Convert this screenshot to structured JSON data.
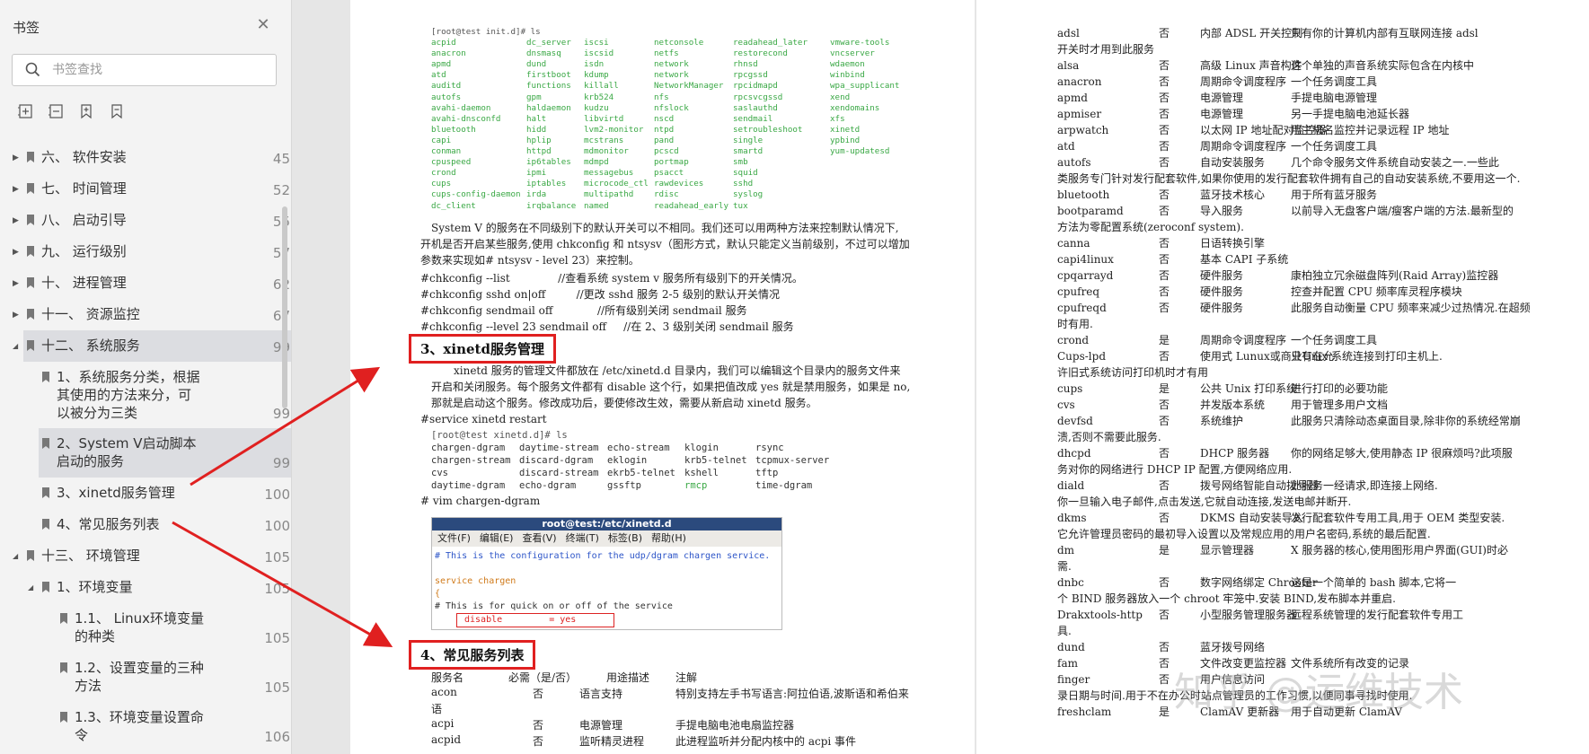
{
  "sidebar": {
    "title": "书签",
    "search_placeholder": "书签查找",
    "tools": [
      "expand-all-icon",
      "collapse-all-icon",
      "add-bookmark-icon",
      "bookmark-icon"
    ],
    "items": [
      {
        "label": "六、 软件安装",
        "page": "45",
        "level": 0,
        "arrow": "▶"
      },
      {
        "label": "七、 时间管理",
        "page": "52",
        "level": 0,
        "arrow": "▶"
      },
      {
        "label": "八、 启动引导",
        "page": "55",
        "level": 0,
        "arrow": "▶"
      },
      {
        "label": "九、 运行级别",
        "page": "57",
        "level": 0,
        "arrow": "▶"
      },
      {
        "label": "十、 进程管理",
        "page": "62",
        "level": 0,
        "arrow": "▶"
      },
      {
        "label": "十一、 资源监控",
        "page": "67",
        "level": 0,
        "arrow": "▶"
      },
      {
        "label": "十二、 系统服务",
        "page": "99",
        "level": 0,
        "arrow": "◢",
        "selected": true
      },
      {
        "label": "1、系统服务分类，根据其使用的方法来分，可以被分为三类",
        "lines": [
          "1、系统服务分类，根据",
          "其使用的方法来分，可",
          "以被分为三类"
        ],
        "page": "99",
        "level": 1
      },
      {
        "label": "2、System V启动脚本启动的服务",
        "lines": [
          "2、System V启动脚本",
          "启动的服务"
        ],
        "page": "99",
        "level": 1,
        "selected": true
      },
      {
        "label": "3、xinetd服务管理",
        "page": "100",
        "level": 1
      },
      {
        "label": "4、常见服务列表",
        "page": "100",
        "level": 1
      },
      {
        "label": "十三、 环境管理",
        "page": "105",
        "level": 0,
        "arrow": "◢"
      },
      {
        "label": "1、环境变量",
        "page": "105",
        "level": 1,
        "arrow": "◢"
      },
      {
        "label": "1.1、 Linux环境变量的种类",
        "lines": [
          "1.1、 Linux环境变量",
          "的种类"
        ],
        "page": "105",
        "level": 2
      },
      {
        "label": "1.2、设置变量的三种方法",
        "lines": [
          "1.2、设置变量的三种",
          "方法"
        ],
        "page": "105",
        "level": 2
      },
      {
        "label": "1.3、环境变量设置命令",
        "lines": [
          "1.3、环境变量设置命",
          "令"
        ],
        "page": "106",
        "level": 2
      }
    ]
  },
  "left_page": {
    "ls_cmd": "[root@test init.d]# ls",
    "ls_items": [
      "acpid",
      "dc_server",
      "iscsi",
      "netconsole",
      "readahead_later",
      "vmware-tools",
      "anacron",
      "dnsmasq",
      "iscsid",
      "netfs",
      "restorecond",
      "vncserver",
      "apmd",
      "dund",
      "isdn",
      "network",
      "rhnsd",
      "wdaemon",
      "atd",
      "firstboot",
      "kdump",
      "network",
      "rpcgssd",
      "winbind",
      "auditd",
      "functions",
      "killall",
      "NetworkManager",
      "rpcidmapd",
      "wpa_supplicant",
      "autofs",
      "gpm",
      "krb524",
      "nfs",
      "rpcsvcgssd",
      "xend",
      "avahi-daemon",
      "haldaemon",
      "kudzu",
      "nfslock",
      "saslauthd",
      "xendomains",
      "avahi-dnsconfd",
      "halt",
      "libvirtd",
      "nscd",
      "sendmail",
      "xfs",
      "bluetooth",
      "hidd",
      "lvm2-monitor",
      "ntpd",
      "setroubleshoot",
      "xinetd",
      "capi",
      "hplip",
      "mcstrans",
      "pand",
      "single",
      "ypbind",
      "conman",
      "httpd",
      "mdmonitor",
      "pcscd",
      "smartd",
      "yum-updatesd",
      "cpuspeed",
      "ip6tables",
      "mdmpd",
      "portmap",
      "smb",
      "",
      "crond",
      "ipmi",
      "messagebus",
      "psacct",
      "squid",
      "",
      "cups",
      "iptables",
      "microcode_ctl",
      "rawdevices",
      "sshd",
      "",
      "cups-config-daemon",
      "irda",
      "multipathd",
      "rdisc",
      "syslog",
      "",
      "dc_client",
      "irqbalance",
      "named",
      "readahead_early",
      "tux",
      ""
    ],
    "para1": [
      "System V 的服务在不同级别下的默认开关可以不相同。我们还可以用两种方法来控制默认情况下,",
      "开机是否开启某些服务,使用 chkconfig 和 ntsysv（图形方式，默认只能定义当前级别，不过可以增加",
      "参数来实现如# ntsysv  - level 23）来控制。"
    ],
    "cmds": [
      "#chkconfig --list              //查看系统 system v 服务所有级别下的开关情况。",
      "#chkconfig sshd on|off         //更改 sshd 服务 2-5 级别的默认开关情况",
      "#chkconfig sendmail off             //所有级别关闭 sendmail 服务",
      "#chkconfig --level 23 sendmail off     //在 2、3 级别关闭 sendmail 服务"
    ],
    "heading3": "3、xinetd服务管理",
    "para2": [
      "xinetd 服务的管理文件都放在 /etc/xinetd.d 目录内，我们可以编辑这个目录内的服务文件来",
      "开启和关闭服务。每个服务文件都有 disable 这个行，如果把值改成 yes 就是禁用服务，如果是 no,",
      "那就是启动这个服务。修改成功后，要使修改生效，需要从新启动 xinetd 服务。"
    ],
    "restart_cmd": "#service xinetd restart",
    "xinetd_ls_cmd": "[root@test xinetd.d]# ls",
    "xinetd_items": [
      "chargen-dgram",
      "daytime-stream",
      "echo-stream",
      "klogin",
      "rsync",
      "chargen-stream",
      "discard-dgram",
      "eklogin",
      "krb5-telnet",
      "tcpmux-server",
      "cvs",
      "discard-stream",
      "ekrb5-telnet",
      "kshell",
      "tftp",
      "daytime-dgram",
      "echo-dgram",
      "gssftp",
      "rmcp",
      "time-dgram"
    ],
    "vim_cmd": "# vim chargen-dgram",
    "terminal": {
      "title": "root@test:/etc/xinetd.d",
      "menu": [
        "文件(F)",
        "编辑(E)",
        "查看(V)",
        "终端(T)",
        "标签(B)",
        "帮助(H)"
      ],
      "line1": "# This is the configuration for the udp/dgram chargen service.",
      "line2": "service chargen",
      "line3": "{",
      "line4": "# This is for quick on or off of the service",
      "disable_key": "disable",
      "disable_val": "= yes"
    },
    "heading4": "4、常见服务列表",
    "svc_header": [
      "服务名",
      "必需（是/否）",
      "用途描述",
      "注解"
    ],
    "svc_rows": [
      {
        "name": "acon",
        "req": "否",
        "purpose": "语言支持",
        "note": "特别支持左手书写语言:阿拉伯语,波斯语和希伯来",
        "wrap": "语"
      },
      {
        "name": "acpi",
        "req": "否",
        "purpose": "电源管理",
        "note": "手提电脑电池电扇监控器"
      },
      {
        "name": "acpid",
        "req": "否",
        "purpose": "监听精灵进程",
        "note": "此进程监听并分配内核中的 acpi 事件"
      }
    ]
  },
  "right_page": {
    "rows": [
      {
        "name": "adsl",
        "req": "否",
        "purpose": "内部 ADSL 开关控制",
        "note": "只有你的计算机内部有互联网连接 adsl",
        "wrap": "开关时才用到此服务"
      },
      {
        "name": "alsa",
        "req": "否",
        "purpose": "高级 Linux 声音构件",
        "note": "这个单独的声音系统实际包含在内核中"
      },
      {
        "name": "anacron",
        "req": "否",
        "purpose": "周期命令调度程序",
        "note": "一个任务调度工具"
      },
      {
        "name": "apmd",
        "req": "否",
        "purpose": "电源管理",
        "note": "手提电脑电源管理"
      },
      {
        "name": "apmiser",
        "req": "否",
        "purpose": "电源管理",
        "note": "另一手提电脑电池延长器"
      },
      {
        "name": "arpwatch",
        "req": "否",
        "purpose": "以太网 IP 地址配对监控器",
        "note": "用主机名监控并记录远程 IP 地址"
      },
      {
        "name": "atd",
        "req": "否",
        "purpose": "周期命令调度程序",
        "note": "一个任务调度工具"
      },
      {
        "name": "autofs",
        "req": "否",
        "purpose": "自动安装服务",
        "note": "几个命令服务文件系统自动安装之一.一些此",
        "wrap": "类服务专门针对发行配套软件,如果你使用的发行配套软件拥有自己的自动安装系统,不要用这一个."
      },
      {
        "name": "bluetooth",
        "req": "否",
        "purpose": "蓝牙技术核心",
        "note": "用于所有蓝牙服务"
      },
      {
        "name": "bootparamd",
        "req": "否",
        "purpose": "导入服务",
        "note": "以前导入无盘客户端/瘦客户端的方法.最新型的",
        "wrap": "方法为零配置系统(zeroconf system)."
      },
      {
        "name": "canna",
        "req": "否",
        "purpose": "日语转换引擎",
        "note": ""
      },
      {
        "name": "capi4linux",
        "req": "否",
        "purpose": "基本 CAPI 子系统",
        "note": ""
      },
      {
        "name": "cpqarrayd",
        "req": "否",
        "purpose": "硬件服务",
        "note": "康柏独立冗余磁盘阵列(Raid Array)监控器"
      },
      {
        "name": "cpufreq",
        "req": "否",
        "purpose": "硬件服务",
        "note": "控查并配置 CPU 频率库灵程序模块"
      },
      {
        "name": "cpufreqd",
        "req": "否",
        "purpose": "硬件服务",
        "note": "此服务自动衡量 CPU 频率来减少过热情况.在超频",
        "wrap": "时有用."
      },
      {
        "name": "crond",
        "req": "是",
        "purpose": "周期命令调度程序",
        "note": "一个任务调度工具"
      },
      {
        "name": "Cups-lpd",
        "req": "否",
        "purpose": "使用式 Lunux或商业Unix 系统连接到打印主机上.",
        "note": "只有在允",
        "wrap": "许旧式系统访问打印机时才有用"
      },
      {
        "name": "cups",
        "req": "是",
        "purpose": "公共 Unix 打印系统",
        "note": "进行打印的必要功能"
      },
      {
        "name": "cvs",
        "req": "否",
        "purpose": "并发版本系统",
        "note": "用于管理多用户文档"
      },
      {
        "name": "devfsd",
        "req": "否",
        "purpose": "系统维护",
        "note": "此服务只清除动态桌面目录,除非你的系统经常崩",
        "wrap": "溃,否则不需要此服务."
      },
      {
        "name": "dhcpd",
        "req": "否",
        "purpose": "DHCP 服务器",
        "note": "你的网络足够大,使用静态 IP 很麻烦吗?此项服",
        "wrap": "务对你的网络进行 DHCP IP 配置,方便网络应用."
      },
      {
        "name": "diald",
        "req": "否",
        "purpose": "拨号网络智能自动拨号器",
        "note": "此服务一经请求,即连接上网络.",
        "wrap": "你一旦输入电子邮件,点击发送,它就自动连接,发送电邮并断开."
      },
      {
        "name": "dkms",
        "req": "否",
        "purpose": "DKMS 自动安装导入",
        "note": "发行配套软件专用工具,用于 OEM 类型安装.",
        "wrap": "它允许管理员密码的最初导入设置以及常规应用的用户名密码,系统的最后配置."
      },
      {
        "name": "dm",
        "req": "是",
        "purpose": "显示管理器",
        "note": "X 服务器的核心,使用图形用户界面(GUI)时必",
        "wrap": "需."
      },
      {
        "name": "dnbc",
        "req": "否",
        "purpose": "数字网络绑定 Chrooter",
        "note": "这是一个简单的 bash 脚本,它将一",
        "wrap": "个 BIND 服务器放入一个 chroot 牢笼中.安装 BIND,发布脚本并重启."
      },
      {
        "name": "Drakxtools-http",
        "req": "否",
        "purpose": "小型服务管理服务器",
        "note": "远程系统管理的发行配套软件专用工",
        "wrap": "具."
      },
      {
        "name": "dund",
        "req": "否",
        "purpose": "蓝牙拨号网络",
        "note": ""
      },
      {
        "name": "fam",
        "req": "否",
        "purpose": "文件改变更监控器",
        "note": "文件系统所有改变的记录"
      },
      {
        "name": "finger",
        "req": "否",
        "purpose": "用户信息访问",
        "note": "",
        "wrap": "录日期与时间.用于不在办公时站点管理员的工作习惯,以便同事寻找时使用."
      },
      {
        "name": "freshclam",
        "req": "是",
        "purpose": "ClamAV 更新器",
        "note": "用于自动更新 ClamAV"
      }
    ],
    "watermark": "知乎 @运维技术"
  }
}
